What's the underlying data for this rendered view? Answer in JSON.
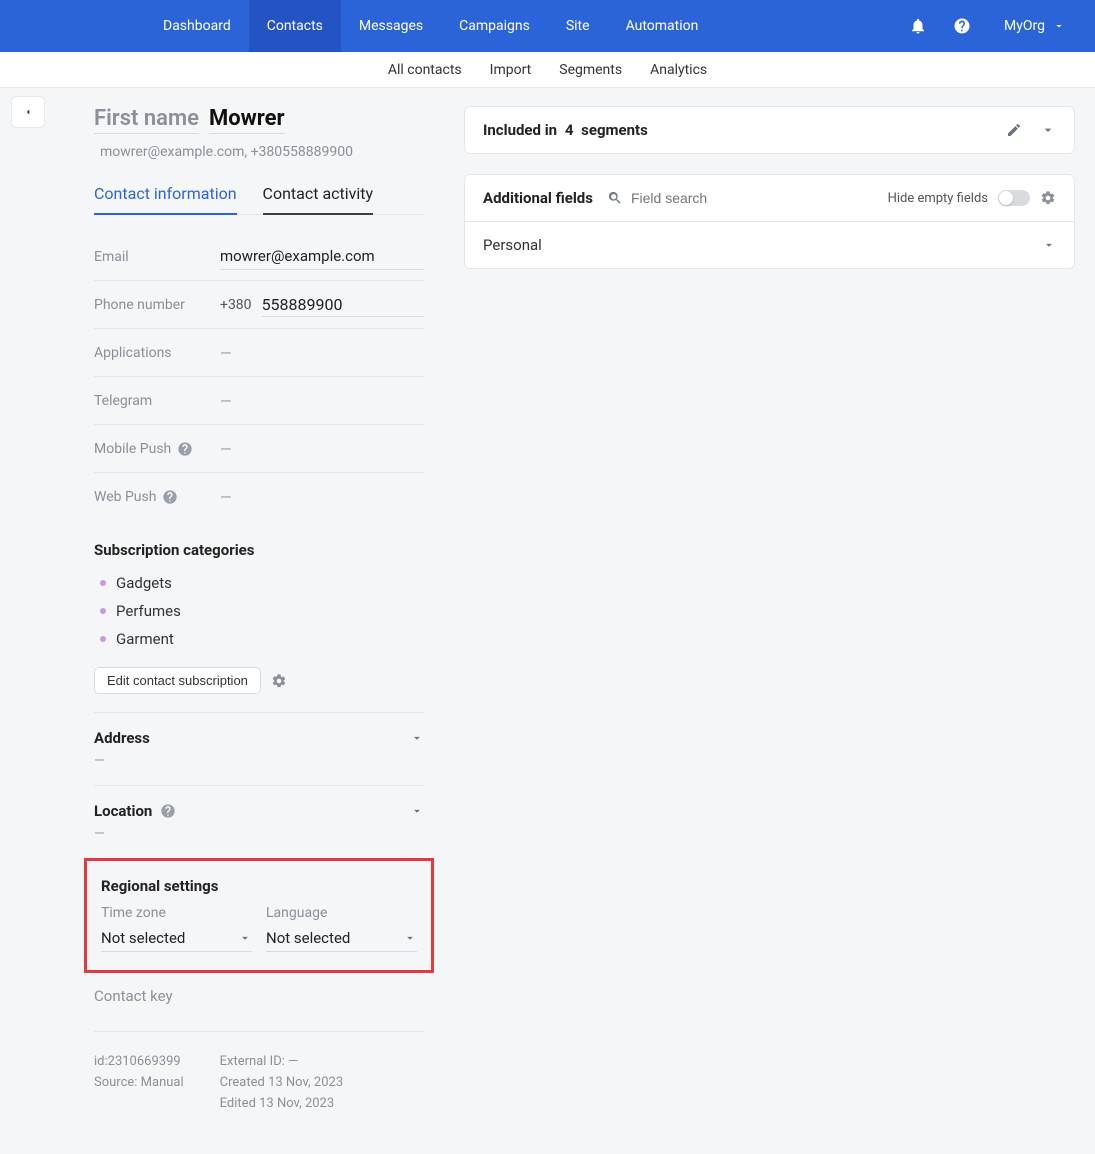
{
  "topnav": {
    "items": [
      "Dashboard",
      "Contacts",
      "Messages",
      "Campaigns",
      "Site",
      "Automation"
    ],
    "org": "MyOrg"
  },
  "subnav": {
    "items": [
      "All contacts",
      "Import",
      "Segments",
      "Analytics"
    ]
  },
  "contact": {
    "first_name_placeholder": "First name",
    "last_name": "Mowrer",
    "summary": "mowrer@example.com, +380558889900"
  },
  "tabs": {
    "info": "Contact information",
    "activity": "Contact activity"
  },
  "fields": {
    "email_label": "Email",
    "email_value": "mowrer@example.com",
    "phone_label": "Phone number",
    "phone_prefix": "+380",
    "phone_value": "558889900",
    "applications_label": "Applications",
    "applications_value": "—",
    "telegram_label": "Telegram",
    "telegram_value": "—",
    "mobilepush_label": "Mobile Push",
    "mobilepush_value": "—",
    "webpush_label": "Web Push",
    "webpush_value": "—"
  },
  "subscription": {
    "title": "Subscription categories",
    "items": [
      "Gadgets",
      "Perfumes",
      "Garment"
    ],
    "edit_label": "Edit contact subscription"
  },
  "address": {
    "title": "Address",
    "value": "—"
  },
  "location": {
    "title": "Location",
    "value": "—"
  },
  "regional": {
    "title": "Regional settings",
    "tz_label": "Time zone",
    "tz_value": "Not selected",
    "lang_label": "Language",
    "lang_value": "Not selected"
  },
  "contact_key": {
    "label": "Contact key"
  },
  "meta": {
    "id_line": "id:2310669399",
    "source_line": "Source: Manual",
    "external_line": "External ID: —",
    "created_line": "Created 13 Nov, 2023",
    "edited_line": "Edited 13 Nov, 2023"
  },
  "segments": {
    "prefix": "Included in",
    "count": "4",
    "suffix": "segments"
  },
  "additional": {
    "title": "Additional fields",
    "search_placeholder": "Field search",
    "hide_label": "Hide empty fields",
    "personal": "Personal"
  }
}
